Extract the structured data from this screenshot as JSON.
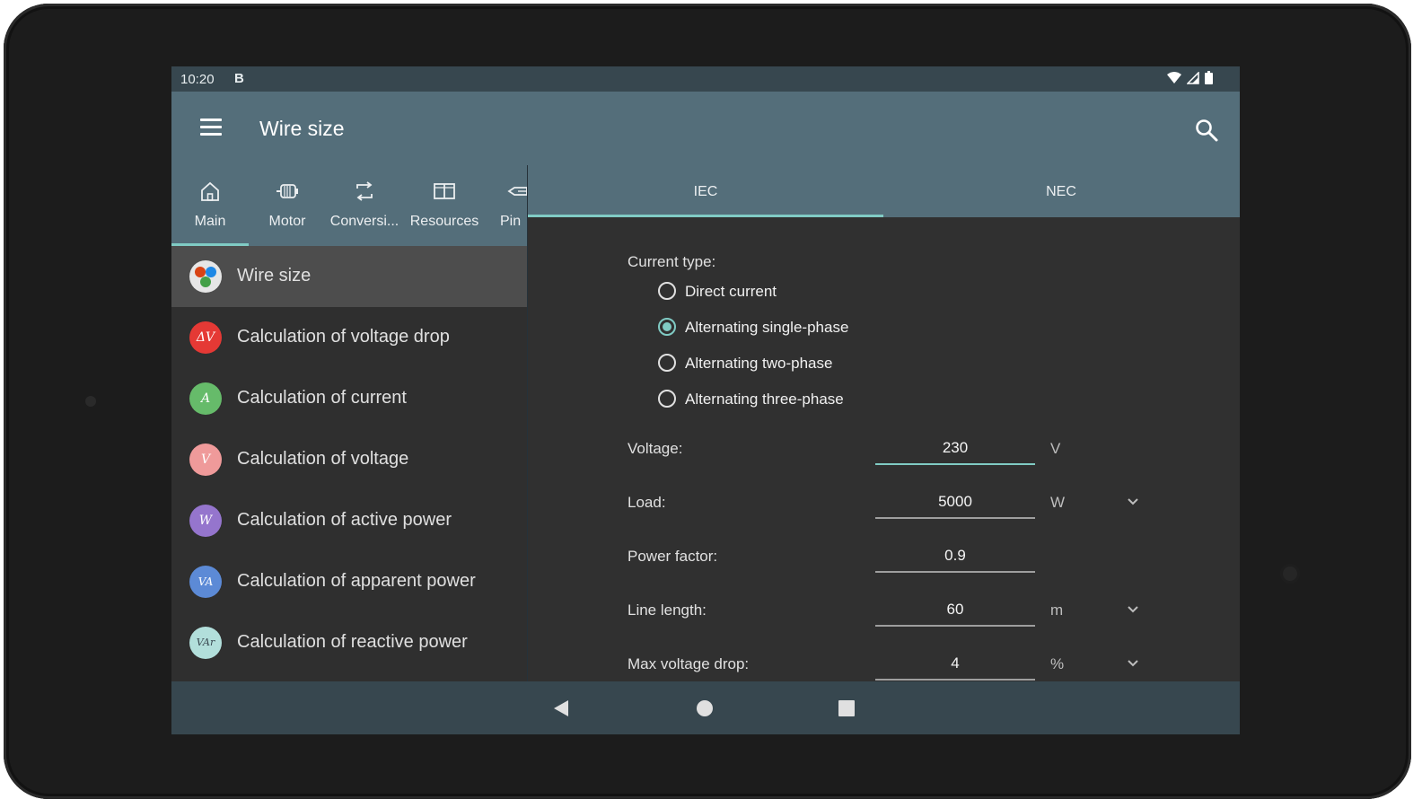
{
  "status": {
    "time": "10:20",
    "notification_icon": "B"
  },
  "appbar": {
    "title": "Wire size"
  },
  "left_tabs": [
    {
      "label": "Main",
      "icon": "home-icon",
      "active": true
    },
    {
      "label": "Motor",
      "icon": "motor-icon",
      "active": false
    },
    {
      "label": "Conversi...",
      "icon": "conversion-icon",
      "active": false
    },
    {
      "label": "Resources",
      "icon": "book-icon",
      "active": false
    },
    {
      "label": "Pin",
      "icon": "pinout-icon",
      "active": false
    }
  ],
  "right_tabs": [
    {
      "label": "IEC",
      "active": true
    },
    {
      "label": "NEC",
      "active": false
    }
  ],
  "list": [
    {
      "label": "Wire size",
      "avatar_text": "",
      "color": "#e0e0e0",
      "selected": true
    },
    {
      "label": "Calculation of voltage drop",
      "avatar_text": "ΔV",
      "color": "#e53935",
      "selected": false
    },
    {
      "label": "Calculation of current",
      "avatar_text": "A",
      "color": "#66bb6a",
      "selected": false
    },
    {
      "label": "Calculation of voltage",
      "avatar_text": "V",
      "color": "#ef9a9a",
      "selected": false
    },
    {
      "label": "Calculation of active power",
      "avatar_text": "W",
      "color": "#9575cd",
      "selected": false
    },
    {
      "label": "Calculation of apparent power",
      "avatar_text": "VA",
      "color": "#5c8ad6",
      "selected": false
    },
    {
      "label": "Calculation of reactive power",
      "avatar_text": "VAr",
      "color": "#b2dfdb",
      "selected": false
    }
  ],
  "form": {
    "current_type_label": "Current type:",
    "current_types": [
      {
        "label": "Direct current",
        "selected": false
      },
      {
        "label": "Alternating single-phase",
        "selected": true
      },
      {
        "label": "Alternating two-phase",
        "selected": false
      },
      {
        "label": "Alternating three-phase",
        "selected": false
      }
    ],
    "fields": [
      {
        "label": "Voltage:",
        "value": "230",
        "unit": "V",
        "dropdown": false,
        "focused": true
      },
      {
        "label": "Load:",
        "value": "5000",
        "unit": "W",
        "dropdown": true,
        "focused": false
      },
      {
        "label": "Power factor:",
        "value": "0.9",
        "unit": "",
        "dropdown": false,
        "focused": false
      },
      {
        "label": "Line length:",
        "value": "60",
        "unit": "m",
        "dropdown": true,
        "focused": false
      },
      {
        "label": "Max voltage drop:",
        "value": "4",
        "unit": "%",
        "dropdown": true,
        "focused": false
      }
    ]
  },
  "colors": {
    "accent": "#80cbc4",
    "appbar": "#546e7a",
    "statusbar": "#37474f",
    "background": "#303030"
  }
}
